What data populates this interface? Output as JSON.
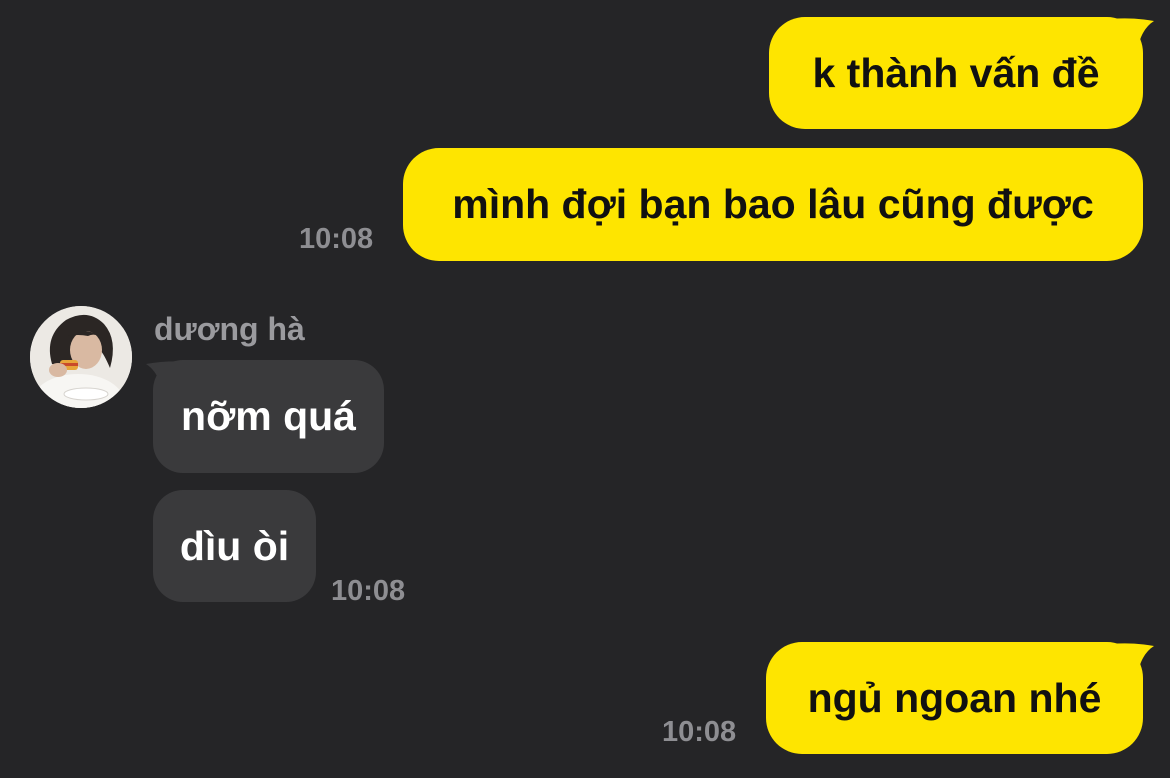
{
  "conversation": {
    "outgoing_1": {
      "text": "k thành vấn đề"
    },
    "outgoing_2": {
      "text": "mình đợi bạn bao lâu cũng được",
      "time": "10:08"
    },
    "incoming_group": {
      "sender": "dương hà",
      "message_1": {
        "text": "nỡm quá"
      },
      "message_2": {
        "text": "dìu òi",
        "time": "10:08"
      }
    },
    "outgoing_3": {
      "text": "ngủ ngoan nhé",
      "time": "10:08"
    }
  },
  "colors": {
    "background": "#252527",
    "outgoing_bubble": "#fee500",
    "incoming_bubble": "#3a3a3c",
    "timestamp": "#8e8e92"
  },
  "icons": {
    "avatar": "user-avatar-photo"
  }
}
